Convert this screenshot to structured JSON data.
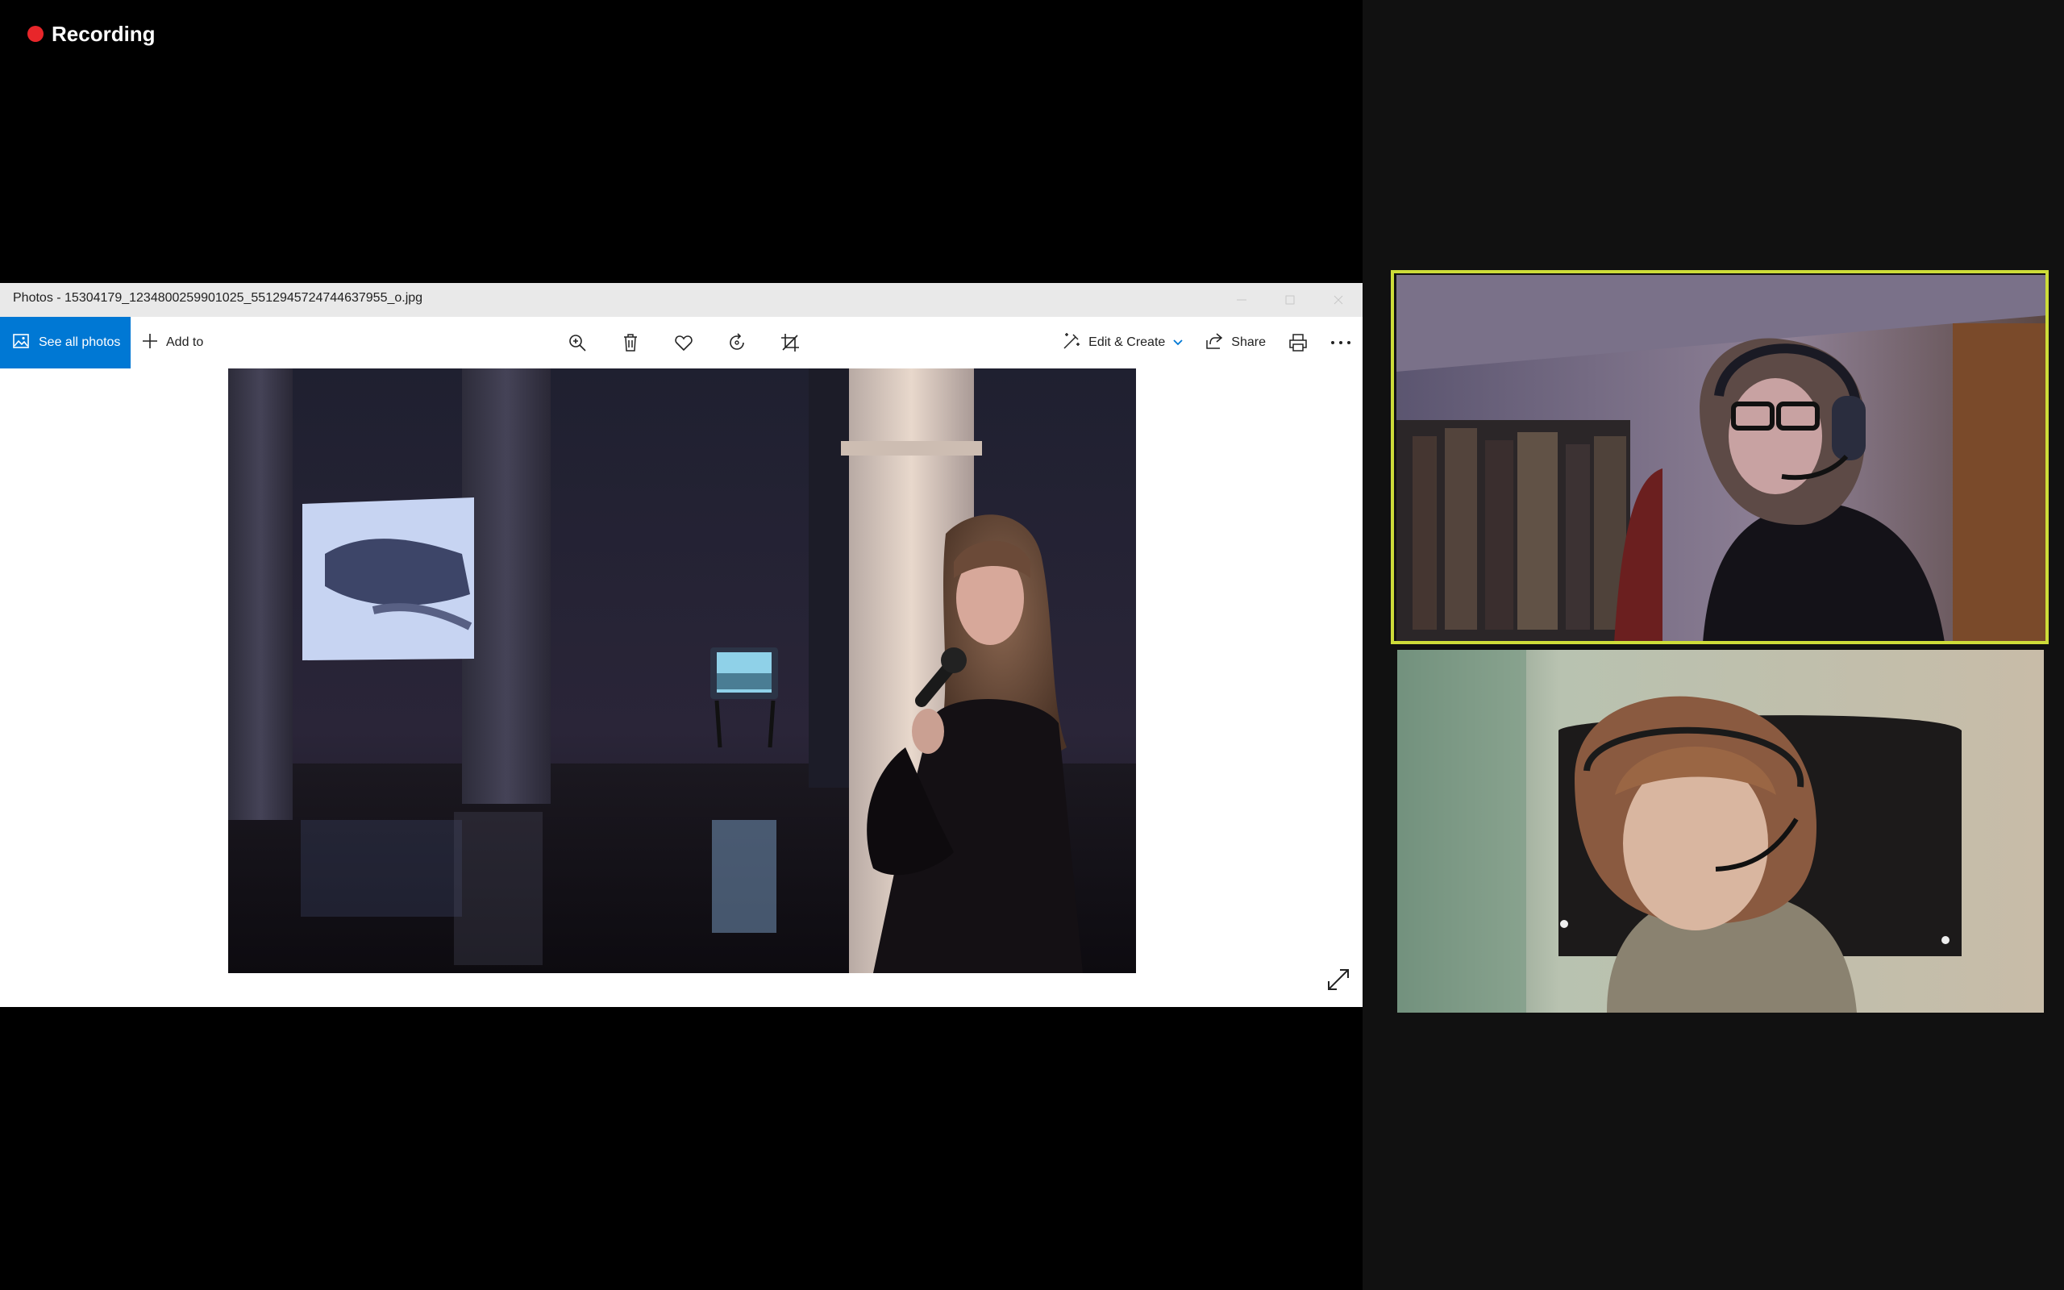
{
  "recording": {
    "label": "Recording",
    "color": "#e8262a"
  },
  "photos_app": {
    "title": "Photos - 15304179_1234800259901025_5512945724744637955_o.jpg",
    "toolbar": {
      "see_all_photos": "See all photos",
      "add_to": "Add to",
      "tools": [
        "zoom-in-icon",
        "delete-icon",
        "favorite-icon",
        "rotate-icon",
        "crop-icon"
      ],
      "edit_create": "Edit & Create",
      "share": "Share",
      "print_icon": "print-icon",
      "more_icon": "more-icon"
    },
    "accent": "#0078d4"
  },
  "participants": {
    "active_speaker_border": "#cddc39",
    "tiles": [
      {
        "role": "active-speaker"
      },
      {
        "role": "participant"
      }
    ]
  }
}
